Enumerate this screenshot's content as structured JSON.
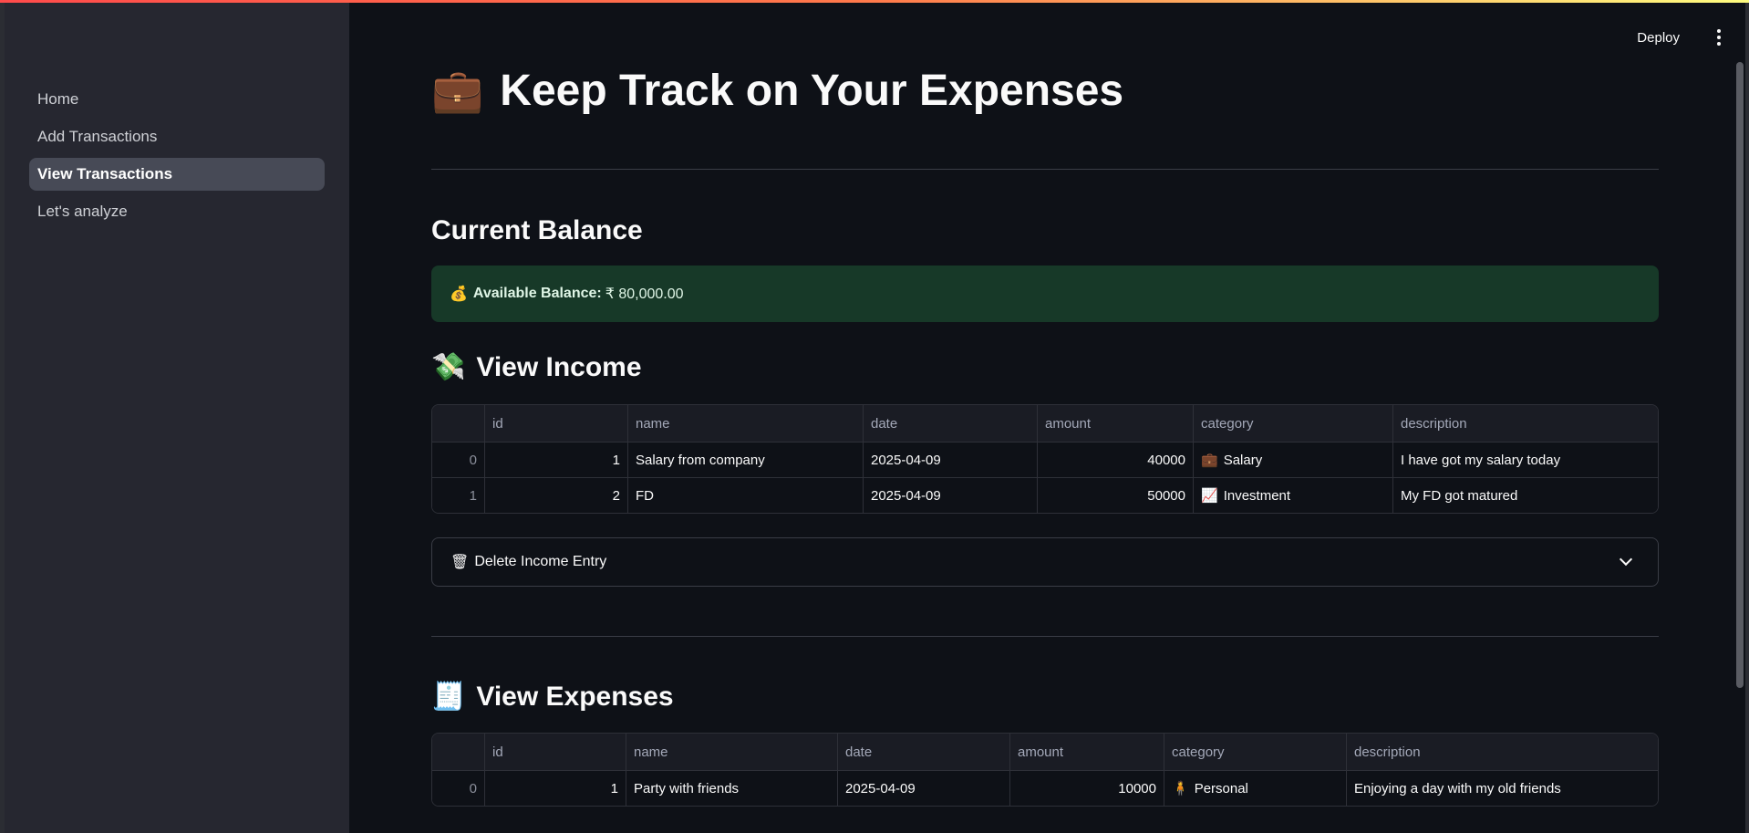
{
  "header": {
    "deploy_label": "Deploy"
  },
  "sidebar": {
    "items": [
      {
        "label": "Home"
      },
      {
        "label": "Add Transactions"
      },
      {
        "label": "View Transactions"
      },
      {
        "label": "Let's analyze"
      }
    ],
    "active_index": 2
  },
  "page": {
    "title_emoji": "💼",
    "title": "Keep Track on Your Expenses"
  },
  "balance": {
    "heading": "Current Balance",
    "emoji": "💰",
    "label": "Available Balance:",
    "value": "₹ 80,000.00"
  },
  "income": {
    "emoji": "💸",
    "heading": "View Income",
    "columns": [
      "",
      "id",
      "name",
      "date",
      "amount",
      "category",
      "description"
    ],
    "rows": [
      {
        "idx": "0",
        "id": "1",
        "name": "Salary from company",
        "date": "2025-04-09",
        "amount": "40000",
        "category_icon": "💼",
        "category": "Salary",
        "description": "I have got my salary today"
      },
      {
        "idx": "1",
        "id": "2",
        "name": "FD",
        "date": "2025-04-09",
        "amount": "50000",
        "category_icon": "📈",
        "category": "Investment",
        "description": "My FD got matured"
      }
    ],
    "delete_emoji": "🗑",
    "delete_label": "Delete Income Entry"
  },
  "expenses": {
    "emoji": "🧾",
    "heading": "View Expenses",
    "columns": [
      "",
      "id",
      "name",
      "date",
      "amount",
      "category",
      "description"
    ],
    "rows": [
      {
        "idx": "0",
        "id": "1",
        "name": "Party with friends",
        "date": "2025-04-09",
        "amount": "10000",
        "category_icon": "🧍",
        "category": "Personal",
        "description": "Enjoying a day with my old friends"
      }
    ]
  },
  "colors": {
    "accent_gradient_start": "#ff4b4b",
    "accent_gradient_end": "#fffd80",
    "success_bg": "#173928",
    "sidebar_bg": "#262730",
    "page_bg": "#0e1117"
  }
}
